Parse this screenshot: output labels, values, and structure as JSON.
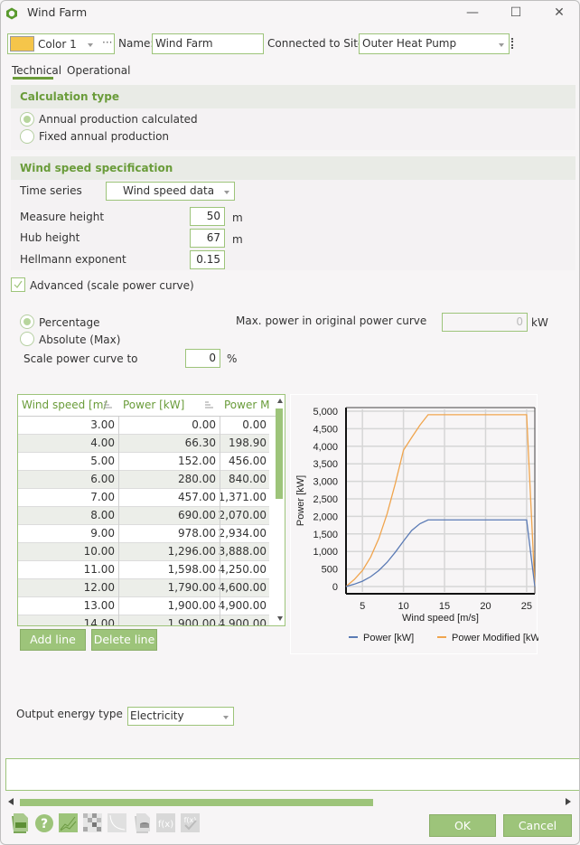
{
  "window": {
    "title": "Wind Farm",
    "controls": [
      "minimize",
      "maximize",
      "close"
    ]
  },
  "header": {
    "color_swatch": "#f5c54a",
    "color_label": "Color 1",
    "more_label": "···",
    "name_label": "Name:",
    "name_value": "Wind Farm",
    "site_label": "Connected to Site:",
    "site_value": "Outer Heat Pump"
  },
  "tabs": [
    {
      "label": "Technical",
      "active": true
    },
    {
      "label": "Operational",
      "active": false
    }
  ],
  "calculation": {
    "title": "Calculation type",
    "options": [
      {
        "label": "Annual production calculated",
        "selected": true
      },
      {
        "label": "Fixed annual production",
        "selected": false
      }
    ]
  },
  "wind_speed": {
    "title": "Wind speed specification",
    "time_series_label": "Time series",
    "time_series_value": "Wind speed data",
    "measure_height_label": "Measure height",
    "measure_height_value": "50",
    "measure_height_unit": "m",
    "hub_height_label": "Hub height",
    "hub_height_value": "67",
    "hub_height_unit": "m",
    "hellmann_label": "Hellmann exponent",
    "hellmann_value": "0.15"
  },
  "advanced": {
    "label": "Advanced (scale power curve)",
    "checked": true,
    "mode_options": [
      {
        "label": "Percentage",
        "selected": true
      },
      {
        "label": "Absolute (Max)",
        "selected": false
      }
    ],
    "max_power_label": "Max. power in original power curve",
    "max_power_value": "0",
    "max_power_unit": "kW",
    "scale_label": "Scale power curve to",
    "scale_value": "0",
    "scale_unit": "%"
  },
  "table": {
    "headers": [
      "Wind speed [m/",
      "Power [kW]",
      "Power M"
    ],
    "rows": [
      [
        "3.00",
        "0.00",
        "0.00"
      ],
      [
        "4.00",
        "66.30",
        "198.90"
      ],
      [
        "5.00",
        "152.00",
        "456.00"
      ],
      [
        "6.00",
        "280.00",
        "840.00"
      ],
      [
        "7.00",
        "457.00",
        "1,371.00"
      ],
      [
        "8.00",
        "690.00",
        "2,070.00"
      ],
      [
        "9.00",
        "978.00",
        "2,934.00"
      ],
      [
        "10.00",
        "1,296.00",
        "3,888.00"
      ],
      [
        "11.00",
        "1,598.00",
        "4,250.00"
      ],
      [
        "12.00",
        "1,790.00",
        "4,600.00"
      ],
      [
        "13.00",
        "1,900.00",
        "4,900.00"
      ],
      [
        "14.00",
        "1,900.00",
        "4,900.00"
      ]
    ],
    "add_label": "Add line",
    "delete_label": "Delete line"
  },
  "chart_data": {
    "type": "line",
    "title": "",
    "xlabel": "Wind speed [m/s]",
    "ylabel": "Power [kW]",
    "xlim": [
      3,
      26
    ],
    "ylim": [
      0,
      5000
    ],
    "xticks": [
      5,
      10,
      15,
      20,
      25
    ],
    "yticks": [
      0,
      500,
      1000,
      1500,
      2000,
      2500,
      3000,
      3500,
      4000,
      4500,
      5000
    ],
    "ytick_labels": [
      "0",
      "500",
      "1,000",
      "1,500",
      "2,000",
      "2,500",
      "3,000",
      "3,500",
      "4,000",
      "4,500",
      "5,000"
    ],
    "grid": true,
    "legend": "bottom",
    "x": [
      3,
      4,
      5,
      6,
      7,
      8,
      9,
      10,
      11,
      12,
      13,
      14,
      15,
      16,
      17,
      18,
      19,
      20,
      21,
      22,
      23,
      24,
      25,
      26
    ],
    "series": [
      {
        "name": "Power [kW]",
        "color": "#5b7bb5",
        "values": [
          0,
          66.3,
          152,
          280,
          457,
          690,
          978,
          1296,
          1598,
          1790,
          1900,
          1900,
          1900,
          1900,
          1900,
          1900,
          1900,
          1900,
          1900,
          1900,
          1900,
          1900,
          1900,
          0
        ]
      },
      {
        "name": "Power Modified [kW]",
        "color": "#f0a54e",
        "values": [
          0,
          198.9,
          456,
          840,
          1371,
          2070,
          2934,
          3888,
          4250,
          4600,
          4900,
          4900,
          4900,
          4900,
          4900,
          4900,
          4900,
          4900,
          4900,
          4900,
          4900,
          4900,
          4900,
          0
        ]
      }
    ]
  },
  "output": {
    "label": "Output energy type",
    "value": "Electricity"
  },
  "footer": {
    "toolbar_icons": [
      "export-file-icon",
      "help-icon",
      "chart-icon",
      "pattern-icon",
      "curve-icon",
      "database-file-icon",
      "function-icon",
      "function-check-icon"
    ],
    "ok_label": "OK",
    "cancel_label": "Cancel"
  }
}
